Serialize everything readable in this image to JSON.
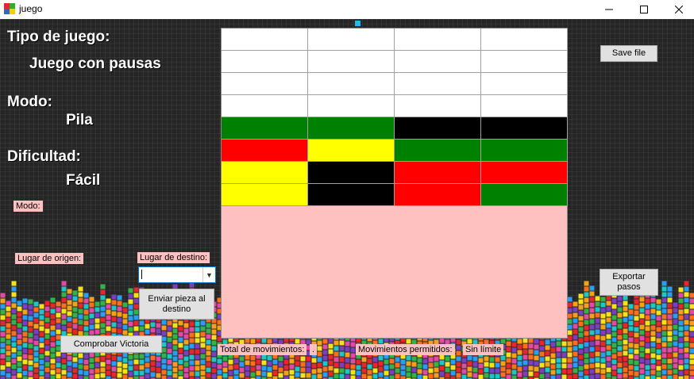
{
  "window": {
    "title": "juego"
  },
  "labels": {
    "tipo_juego": "Tipo de juego:",
    "tipo_value": "Juego con pausas",
    "modo": "Modo:",
    "modo_value": "Pila",
    "dificultad": "Dificultad:",
    "dificultad_value": "Fácil",
    "modo_small": "Modo:",
    "origen": "Lugar de origen:",
    "destino": "Lugar de destino:",
    "total_movs": "Total de movimientos:",
    "total_movs_value": ".",
    "movs_permitidos": "Movimientos permitidos:",
    "movs_permitidos_value": "Sin límite"
  },
  "buttons": {
    "save": "Save file",
    "exportar": "Exportar pasos",
    "enviar": "Enviar pieza al destino",
    "comprobar": "Comprobar Victoria"
  },
  "combo": {
    "value": ""
  },
  "colors": {
    "W": "#ffffff",
    "G": "#008000",
    "K": "#000000",
    "R": "#ff0000",
    "Y": "#ffff00"
  },
  "board": {
    "rows": [
      [
        "W",
        "W",
        "W",
        "W"
      ],
      [
        "W",
        "W",
        "W",
        "W"
      ],
      [
        "W",
        "W",
        "W",
        "W"
      ],
      [
        "W",
        "W",
        "W",
        "W"
      ],
      [
        "G",
        "G",
        "K",
        "K"
      ],
      [
        "R",
        "Y",
        "G",
        "G"
      ],
      [
        "Y",
        "K",
        "R",
        "R"
      ],
      [
        "Y",
        "K",
        "R",
        "G"
      ]
    ]
  }
}
